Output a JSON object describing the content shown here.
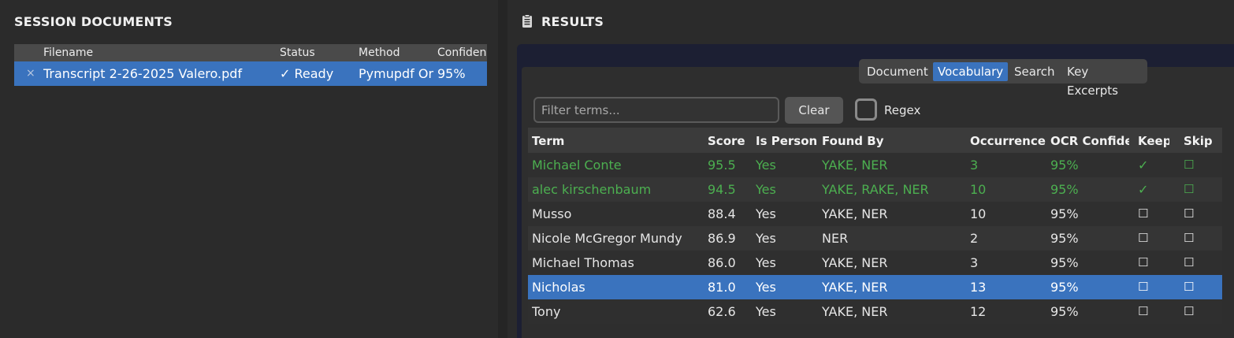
{
  "session": {
    "title": "SESSION DOCUMENTS",
    "columns": [
      "Filename",
      "Status",
      "Method",
      "Confidence"
    ],
    "documents": [
      {
        "remove_icon": "×",
        "filename": "Transcript 2-26-2025 Valero.pdf",
        "status": "✓ Ready",
        "method": "Pymupdf Or",
        "confidence": "95%"
      }
    ]
  },
  "results": {
    "title": "RESULTS",
    "icon": "clipboard-icon",
    "tabs": [
      "Document",
      "Vocabulary",
      "Search",
      "Key Excerpts"
    ],
    "active_tab": "Vocabulary",
    "filter": {
      "placeholder": "Filter terms...",
      "value": ""
    },
    "clear_label": "Clear",
    "regex_label": "Regex",
    "columns": [
      "Term",
      "Score",
      "Is Person",
      "Found By",
      "Occurrences",
      "OCR Confidence",
      "Keep",
      "Skip"
    ],
    "rows": [
      {
        "term": "Michael Conte",
        "score": "95.5",
        "is_person": "Yes",
        "found_by": "YAKE, NER",
        "occurrences": "3",
        "ocr": "95%",
        "keep": "✓",
        "skip": "☐"
      },
      {
        "term": "alec kirschenbaum",
        "score": "94.5",
        "is_person": "Yes",
        "found_by": "YAKE, RAKE, NER",
        "occurrences": "10",
        "ocr": "95%",
        "keep": "✓",
        "skip": "☐"
      },
      {
        "term": "Musso",
        "score": "88.4",
        "is_person": "Yes",
        "found_by": "YAKE, NER",
        "occurrences": "10",
        "ocr": "95%",
        "keep": "☐",
        "skip": "☐"
      },
      {
        "term": "Nicole McGregor Mundy",
        "score": "86.9",
        "is_person": "Yes",
        "found_by": "NER",
        "occurrences": "2",
        "ocr": "95%",
        "keep": "☐",
        "skip": "☐"
      },
      {
        "term": "Michael Thomas",
        "score": "86.0",
        "is_person": "Yes",
        "found_by": "YAKE, NER",
        "occurrences": "3",
        "ocr": "95%",
        "keep": "☐",
        "skip": "☐"
      },
      {
        "term": "Nicholas",
        "score": "81.0",
        "is_person": "Yes",
        "found_by": "YAKE, NER",
        "occurrences": "13",
        "ocr": "95%",
        "keep": "☐",
        "skip": "☐"
      },
      {
        "term": "Tony",
        "score": "62.6",
        "is_person": "Yes",
        "found_by": "YAKE, NER",
        "occurrences": "12",
        "ocr": "95%",
        "keep": "☐",
        "skip": "☐"
      }
    ]
  }
}
